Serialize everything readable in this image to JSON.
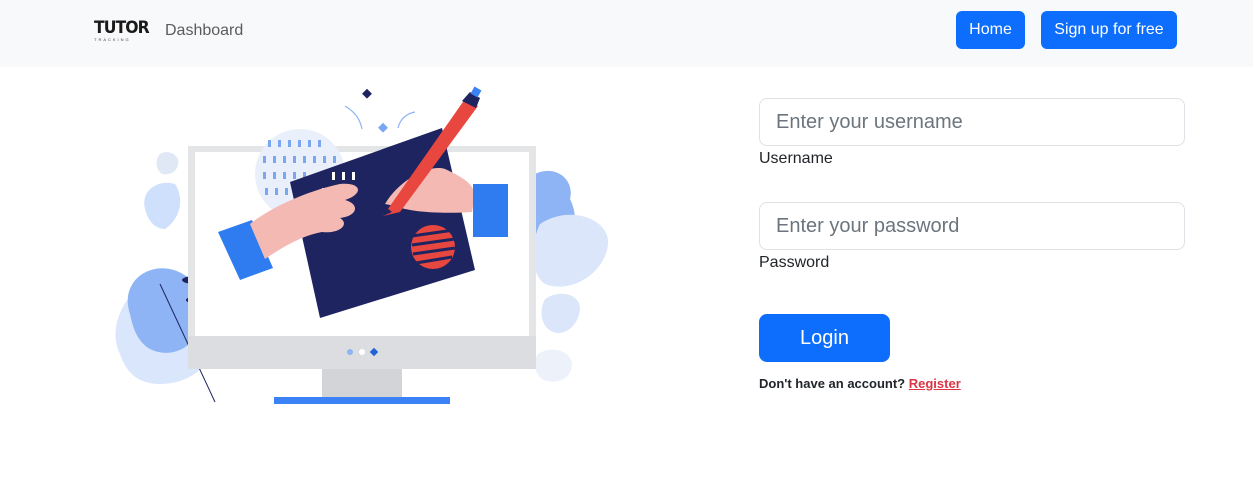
{
  "navbar": {
    "brand": "TUTOR",
    "brand_sub": "TRACKING",
    "dashboard_label": "Dashboard",
    "home_label": "Home",
    "signup_label": "Sign up for free"
  },
  "form": {
    "username_placeholder": "Enter your username",
    "username_label": "Username",
    "password_placeholder": "Enter your password",
    "password_label": "Password",
    "login_label": "Login",
    "register_prompt": "Don't have an account?",
    "register_link": "Register"
  },
  "colors": {
    "primary": "#0d6efd",
    "navbar_bg": "#f8f9fa",
    "link_danger": "#dc3545",
    "illustration_navy": "#1e2460",
    "illustration_blue": "#3b82f6",
    "illustration_red": "#e8473f"
  }
}
